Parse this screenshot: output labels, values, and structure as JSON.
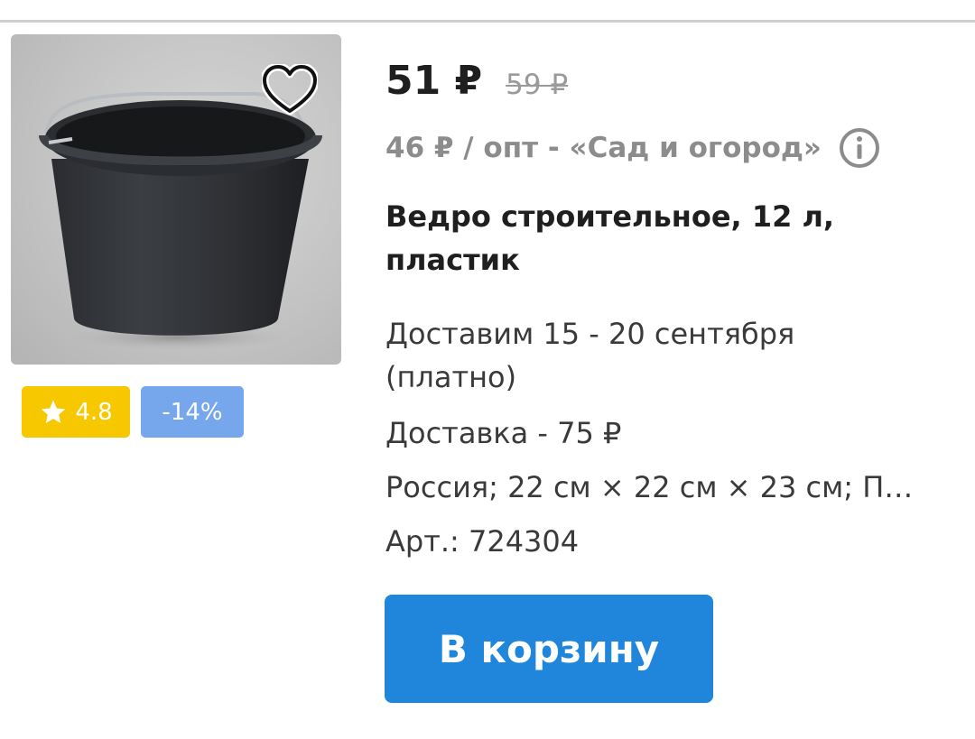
{
  "product": {
    "price": "51 ₽",
    "old_price": "59 ₽",
    "wholesale": "46 ₽ / опт - «Сад и огород»",
    "title": "Ведро строительное, 12 л, пластик",
    "delivery_date": "Доставим 15 - 20 сентября (платно)",
    "delivery_cost": "Доставка - 75 ₽",
    "specs": "Россия; 22 см × 22 см × 23 см; Пл...",
    "article": "Арт.: 724304",
    "image_alt": "Черное пластиковое ведро"
  },
  "badges": {
    "rating": "4.8",
    "discount": "-14%"
  },
  "actions": {
    "cart_label": "В корзину"
  },
  "icons": {
    "favorite": "heart-icon",
    "info": "info-icon",
    "rating": "star-icon"
  },
  "colors": {
    "accent_button": "#1f86db",
    "rating_badge": "#f7c800",
    "discount_badge": "#76a6ec",
    "muted_text": "#8c8c8c"
  }
}
